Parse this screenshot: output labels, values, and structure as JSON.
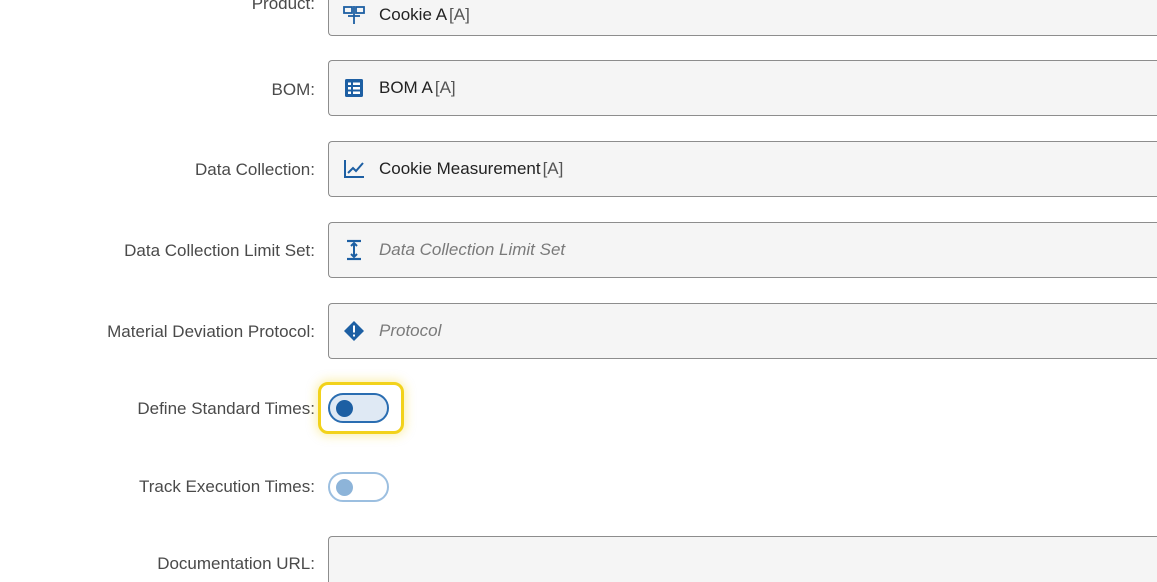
{
  "fields": {
    "product": {
      "label": "Product:",
      "value": "Cookie A",
      "revision": "[A]",
      "icon": "product-icon"
    },
    "bom": {
      "label": "BOM:",
      "value": "BOM A",
      "revision": "[A]",
      "icon": "bom-list-icon"
    },
    "data_collection": {
      "label": "Data Collection:",
      "value": "Cookie Measurement",
      "revision": "[A]",
      "icon": "line-chart-icon"
    },
    "data_collection_limit_set": {
      "label": "Data Collection Limit Set:",
      "placeholder": "Data Collection Limit Set",
      "icon": "limit-range-icon"
    },
    "material_deviation_protocol": {
      "label": "Material Deviation Protocol:",
      "placeholder": "Protocol",
      "icon": "protocol-diamond-icon"
    },
    "define_standard_times": {
      "label": "Define Standard Times:",
      "state": "off",
      "focused": true
    },
    "track_execution_times": {
      "label": "Track Execution Times:",
      "state": "off",
      "disabled": true
    },
    "documentation_url": {
      "label": "Documentation URL:",
      "value": ""
    }
  },
  "colors": {
    "accent": "#1d5fa3",
    "focus_ring": "#f2d21b",
    "field_bg": "#f5f5f5",
    "field_border": "#8d8d8d",
    "label_text": "#4a4a4a"
  }
}
